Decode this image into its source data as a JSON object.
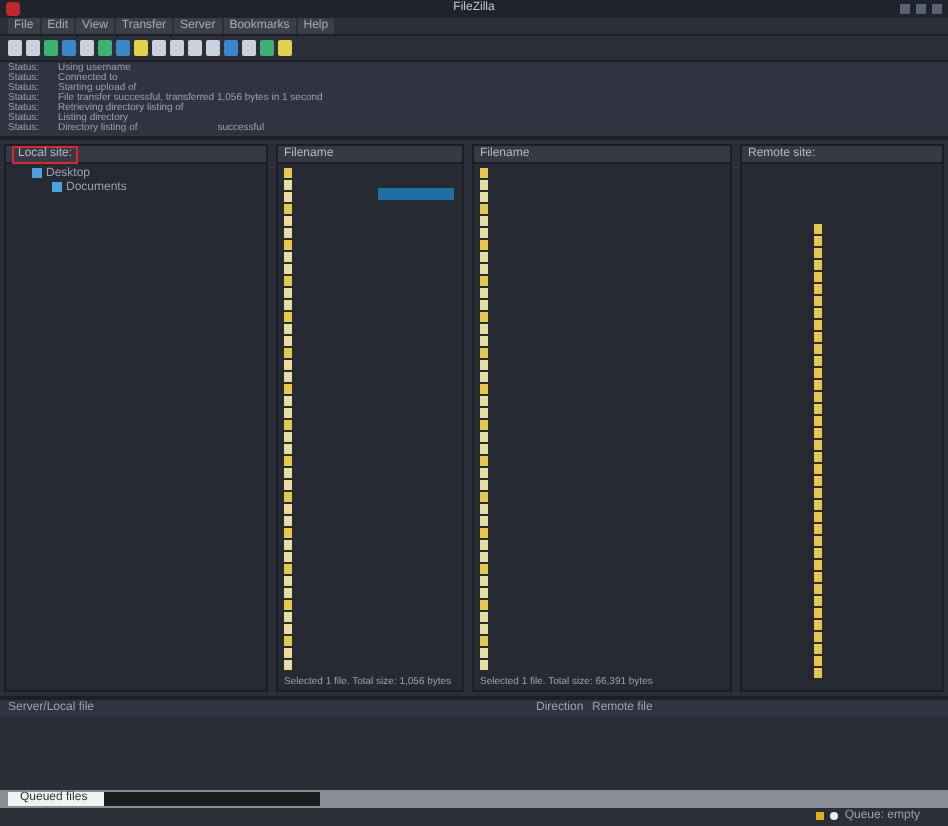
{
  "window": {
    "title": "FileZilla"
  },
  "menu": [
    "File",
    "Edit",
    "View",
    "Transfer",
    "Server",
    "Bookmarks",
    "Help"
  ],
  "log": [
    {
      "label": "Status:",
      "message": "Using username"
    },
    {
      "label": "Status:",
      "message": "Connected to"
    },
    {
      "label": "Status:",
      "message": "Starting upload of"
    },
    {
      "label": "Status:",
      "message": "File transfer successful, transferred 1,056 bytes in 1 second"
    },
    {
      "label": "Status:",
      "message": "Retrieving directory listing of"
    },
    {
      "label": "Status:",
      "message": "Listing directory"
    },
    {
      "label": "Status:",
      "message": "Directory listing of",
      "suffix": "successful"
    }
  ],
  "local_site": {
    "label": "Local site:",
    "tree": [
      {
        "name": "Desktop",
        "children": [
          {
            "name": "Documents"
          }
        ]
      }
    ]
  },
  "local_files": {
    "column": "Filename",
    "status": "Selected 1 file. Total size: 1,056 bytes"
  },
  "remote_files": {
    "column": "Filename",
    "status": "Selected 1 file. Total size: 66,391 bytes"
  },
  "remote_site": {
    "label": "Remote site:"
  },
  "queue": {
    "columns": [
      "Server/Local file",
      "Direction",
      "Remote file"
    ]
  },
  "tabs": [
    {
      "label": "Queued files",
      "selected": true
    },
    {
      "selected": false
    }
  ],
  "status_bar": {
    "queue": "Queue: empty"
  }
}
